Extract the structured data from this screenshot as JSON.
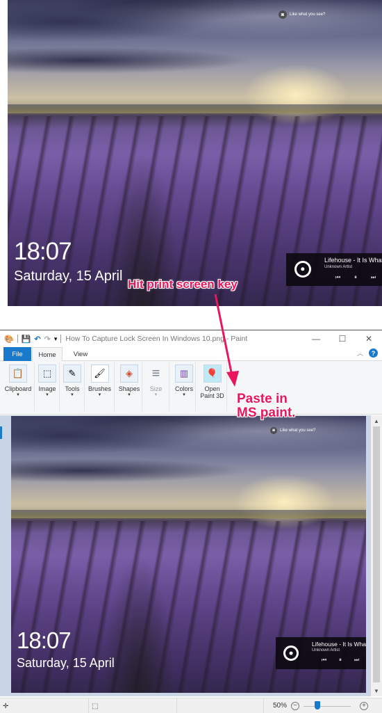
{
  "lock_screen": {
    "notice": "Like what you see?",
    "time": "18:07",
    "date": "Saturday, 15 April",
    "media": {
      "title": "Lifehouse - It Is What It Is",
      "artist": "Unknown Artist",
      "prev_icon": "⏮",
      "pause_icon": "⏸",
      "next_icon": "⏭"
    }
  },
  "annotations": {
    "print_screen": "Hit print screen key",
    "paste_line1": "Paste in",
    "paste_line2": "MS paint.",
    "color": "#e8175d"
  },
  "paint": {
    "window_title": "How To Capture Lock Screen In Windows 10.png - Paint",
    "window_controls": {
      "minimize": "—",
      "maximize": "☐",
      "close": "✕"
    },
    "tabs": [
      {
        "label": "File"
      },
      {
        "label": "Home"
      },
      {
        "label": "View"
      }
    ],
    "help_label": "?",
    "ribbon_groups": [
      {
        "label": "Clipboard",
        "icon": "📋"
      },
      {
        "label": "Image",
        "icon": "⬚"
      },
      {
        "label": "Tools",
        "icon": "✎"
      },
      {
        "label": "Brushes",
        "icon": "🖌"
      },
      {
        "label": "Shapes",
        "icon": "◈"
      },
      {
        "label": "Size",
        "icon": "≡"
      },
      {
        "label": "Colors",
        "icon": "▥"
      },
      {
        "label": "Open Paint 3D",
        "icon": "🎈"
      }
    ],
    "status": {
      "zoom": "50%",
      "zoom_fraction": 0.3
    },
    "accent": "#1979ca"
  }
}
